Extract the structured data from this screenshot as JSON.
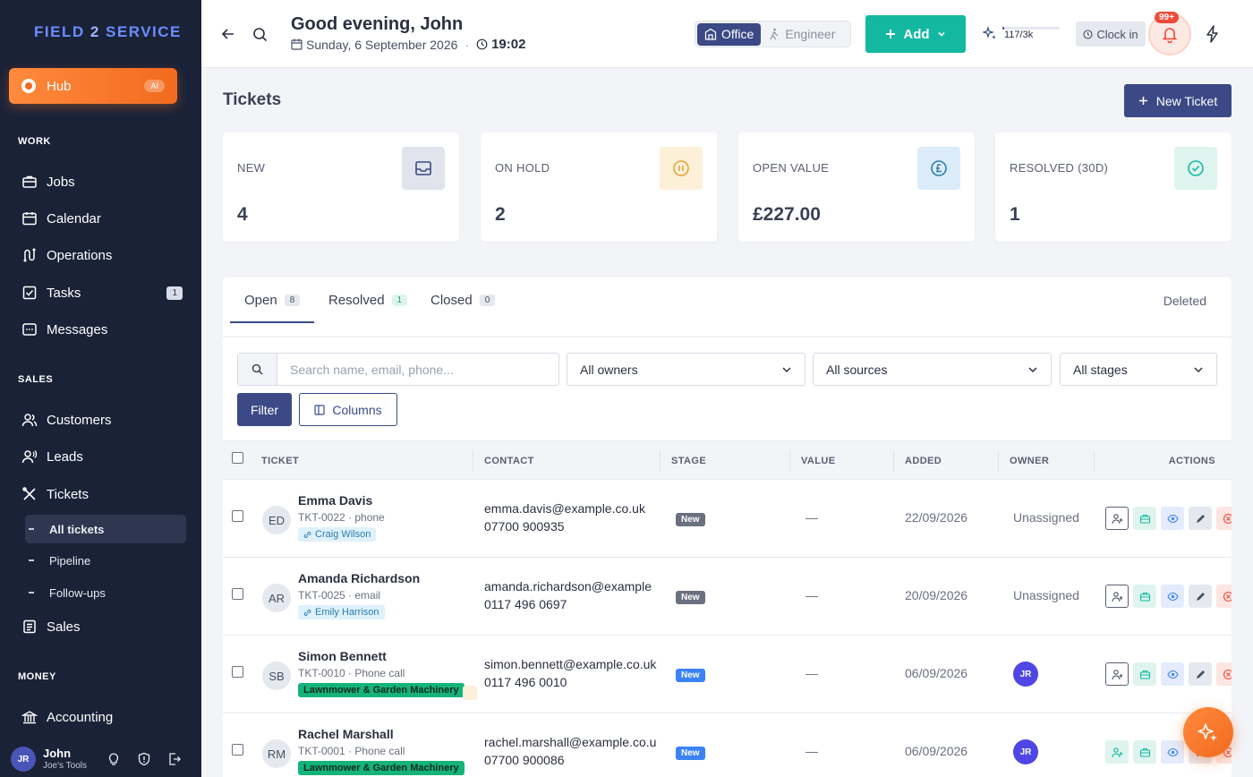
{
  "brand": {
    "part1": "FIELD",
    "part2": "2",
    "part3": "SERVICE"
  },
  "sidebar": {
    "hub": {
      "label": "Hub",
      "badge": "AI"
    },
    "sections": {
      "work": "WORK",
      "sales": "SALES",
      "money": "MONEY"
    },
    "work_items": [
      {
        "label": "Jobs"
      },
      {
        "label": "Calendar"
      },
      {
        "label": "Operations"
      },
      {
        "label": "Tasks",
        "count": "1"
      },
      {
        "label": "Messages"
      }
    ],
    "sales_items": [
      {
        "label": "Customers"
      },
      {
        "label": "Leads"
      },
      {
        "label": "Tickets"
      }
    ],
    "ticket_sub": [
      {
        "label": "All tickets"
      },
      {
        "label": "Pipeline"
      },
      {
        "label": "Follow-ups"
      }
    ],
    "sales_after": {
      "label": "Sales"
    },
    "money_items": [
      {
        "label": "Accounting"
      }
    ],
    "user": {
      "initials": "JR",
      "name": "John",
      "company": "Joe's Tools"
    }
  },
  "header": {
    "greeting": "Good evening, John",
    "date": "Sunday, 6 September 2026",
    "time": "19:02",
    "mode_office": "Office",
    "mode_engineer": "Engineer",
    "add_label": "Add",
    "usage_text": "117/3k",
    "usage_fraction": 0.039,
    "clock_in": "Clock in",
    "notifications_badge": "99+"
  },
  "page": {
    "title": "Tickets",
    "new_ticket": "New Ticket"
  },
  "stats": [
    {
      "label": "NEW",
      "value": "4"
    },
    {
      "label": "ON HOLD",
      "value": "2"
    },
    {
      "label": "OPEN VALUE",
      "value": "£227.00"
    },
    {
      "label": "RESOLVED (30D)",
      "value": "1"
    }
  ],
  "tabs": [
    {
      "label": "Open",
      "count": "8"
    },
    {
      "label": "Resolved",
      "count": "1"
    },
    {
      "label": "Closed",
      "count": "0"
    }
  ],
  "deleted_label": "Deleted",
  "filters": {
    "search_placeholder": "Search name, email, phone...",
    "owners": "All owners",
    "sources": "All sources",
    "stages": "All stages",
    "filter_btn": "Filter",
    "columns_btn": "Columns"
  },
  "columns": {
    "ticket": "TICKET",
    "contact": "CONTACT",
    "stage": "STAGE",
    "value": "VALUE",
    "added": "ADDED",
    "owner": "OWNER",
    "actions": "ACTIONS"
  },
  "rows": [
    {
      "initials": "ED",
      "name": "Emma Davis",
      "sub": "TKT-0022 · phone",
      "tag": "Craig Wilson",
      "email": "emma.davis@example.co.uk",
      "phone": "07700 900935",
      "stage": "New",
      "value": "—",
      "added": "22/09/2026",
      "owner": "Unassigned"
    },
    {
      "initials": "AR",
      "name": "Amanda Richardson",
      "sub": "TKT-0025 · email",
      "tag": "Emily Harrison",
      "email": "amanda.richardson@example",
      "phone": "0117 496 0697",
      "stage": "New",
      "value": "—",
      "added": "20/09/2026",
      "owner": "Unassigned"
    },
    {
      "initials": "SB",
      "name": "Simon Bennett",
      "sub": "TKT-0010 · Phone call",
      "tag": "Lawnmower & Garden Machinery",
      "email": "simon.bennett@example.co.uk",
      "phone": "0117 496 0010",
      "stage": "New",
      "value": "—",
      "added": "06/09/2026",
      "owner": "JR"
    },
    {
      "initials": "RM",
      "name": "Rachel Marshall",
      "sub": "TKT-0001 · Phone call",
      "tag": "Lawnmower & Garden Machinery",
      "email": "rachel.marshall@example.co.u",
      "phone": "07700 900086",
      "stage": "New",
      "value": "—",
      "added": "06/09/2026",
      "owner": "JR"
    }
  ]
}
